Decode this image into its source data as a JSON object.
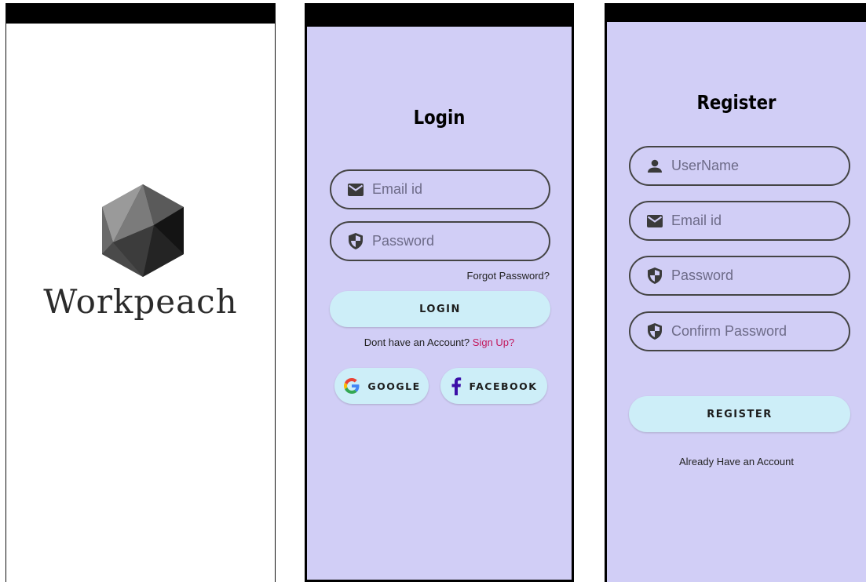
{
  "splash": {
    "brand_name": "Workpeach",
    "logo_icon": "hexagon-logo-icon"
  },
  "login": {
    "title": "Login",
    "email": {
      "placeholder": "Email id",
      "icon": "mail-icon"
    },
    "password": {
      "placeholder": "Password",
      "icon": "shield-icon"
    },
    "forgot_password": "Forgot Password?",
    "login_button": "LOGIN",
    "signup_prompt": "Dont have an Account?",
    "signup_link": "Sign Up?",
    "google_button": "GOOGLE",
    "facebook_button": "FACEBOOK"
  },
  "register": {
    "title": "Register",
    "username": {
      "placeholder": "UserName",
      "icon": "person-icon"
    },
    "email": {
      "placeholder": "Email id",
      "icon": "mail-icon"
    },
    "password": {
      "placeholder": "Password",
      "icon": "shield-icon"
    },
    "confirm_password": {
      "placeholder": "Confirm Password",
      "icon": "shield-icon"
    },
    "register_button": "REGISTER",
    "login_link": "Already Have an Account"
  },
  "colors": {
    "screen_background": "#d1cef6",
    "button_background": "#cdeef8",
    "link_accent": "#c2185b",
    "facebook_blue": "#3b0fa8"
  }
}
